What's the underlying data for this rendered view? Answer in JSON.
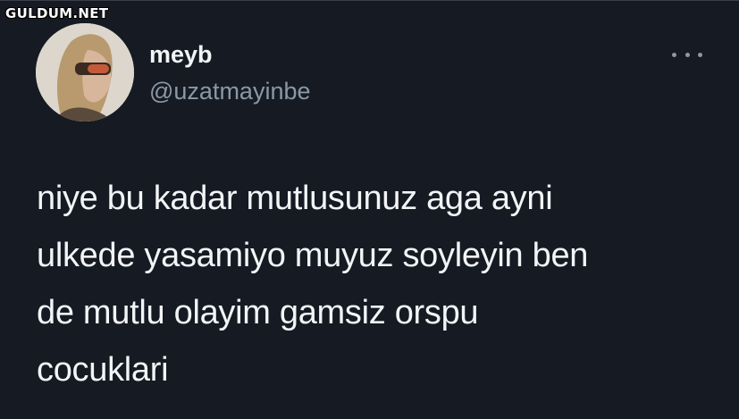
{
  "watermark": "GULDUM.NET",
  "tweet": {
    "author_name": "meyb",
    "author_handle": "@uzatmayinbe",
    "text_lines": [
      "niye bu kadar mutlusunuz aga ayni",
      "ulkede yasamiyo muyuz soyleyin ben",
      "de mutlu olayim gamsiz orspu",
      "cocuklari"
    ]
  },
  "icons": {
    "more": "more-options-icon",
    "avatar": "profile-avatar"
  },
  "colors": {
    "background": "#151a23",
    "primary_text": "#f2f4f6",
    "secondary_text": "#8b98a5"
  }
}
